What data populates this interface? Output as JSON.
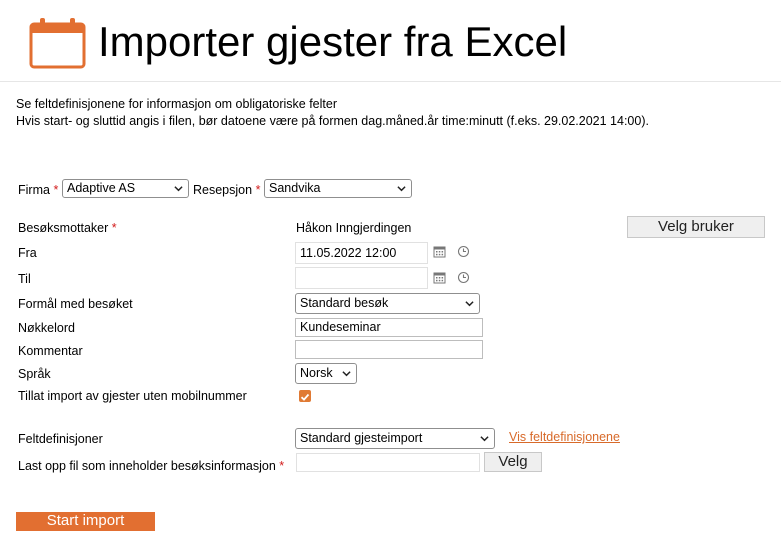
{
  "header": {
    "title": "Importer gjester fra Excel",
    "icon": "calendar-icon",
    "accent": "#e26f31"
  },
  "info": {
    "line1": "Se feltdefinisjonene for informasjon om obligatoriske felter",
    "line2": "Hvis start- og sluttid angis i filen, bør datoene være på formen dag.måned.år time:minutt (f.eks. 29.02.2021 14:00)."
  },
  "form": {
    "company": {
      "label": "Firma",
      "required_mark": "*",
      "value": "Adaptive AS"
    },
    "reception": {
      "label": "Resepsjon",
      "required_mark": "*",
      "value": "Sandvika"
    },
    "host": {
      "label": "Besøksmottaker",
      "required_mark": "*",
      "value": "Håkon Inngjerdingen",
      "button_label": "Velg bruker"
    },
    "from": {
      "label": "Fra",
      "value": "11.05.2022 12:00"
    },
    "to": {
      "label": "Til",
      "value": ""
    },
    "purpose": {
      "label": "Formål med besøket",
      "value": "Standard besøk"
    },
    "keyword": {
      "label": "Nøkkelord",
      "value": "Kundeseminar"
    },
    "comment": {
      "label": "Kommentar",
      "value": ""
    },
    "language": {
      "label": "Språk",
      "value": "Norsk"
    },
    "allow_no_mobile": {
      "label": "Tillat import av gjester uten mobilnummer",
      "checked": true
    },
    "field_definitions": {
      "label": "Feltdefinisjoner",
      "value": "Standard gjesteimport",
      "link_label": "Vis feltdefinisjonene"
    },
    "upload": {
      "label": "Last opp fil som inneholder besøksinformasjon",
      "required_mark": "*",
      "value": "",
      "button_label": "Velg"
    }
  },
  "actions": {
    "start_label": "Start import"
  }
}
